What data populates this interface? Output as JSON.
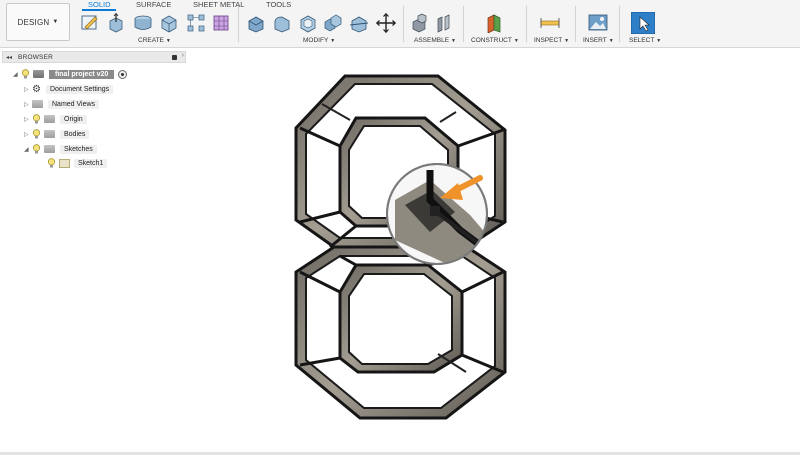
{
  "toolbar": {
    "workspace_button": "DESIGN",
    "tabs": [
      "SOLID",
      "SURFACE",
      "SHEET METAL",
      "TOOLS"
    ],
    "active_tab": "SOLID",
    "groups": [
      "CREATE",
      "MODIFY",
      "ASSEMBLE",
      "CONSTRUCT",
      "INSPECT",
      "INSERT",
      "SELECT"
    ]
  },
  "browser": {
    "title": "BROWSER",
    "items": [
      {
        "label": "final project v20",
        "icon": "component-icon"
      },
      {
        "label": "Document Settings",
        "icon": "gear-icon"
      },
      {
        "label": "Named Views",
        "icon": "folder-icon"
      },
      {
        "label": "Origin",
        "icon": "folder-icon"
      },
      {
        "label": "Bodies",
        "icon": "folder-icon"
      },
      {
        "label": "Sketches",
        "icon": "folder-icon"
      },
      {
        "label": "Sketch1",
        "icon": "sketch-icon"
      }
    ]
  },
  "colors": {
    "accent": "#0a7ad8",
    "highlight_arrow": "#f0922a",
    "model_fill": "#8f8a80",
    "model_edge": "#1a1a1a"
  }
}
